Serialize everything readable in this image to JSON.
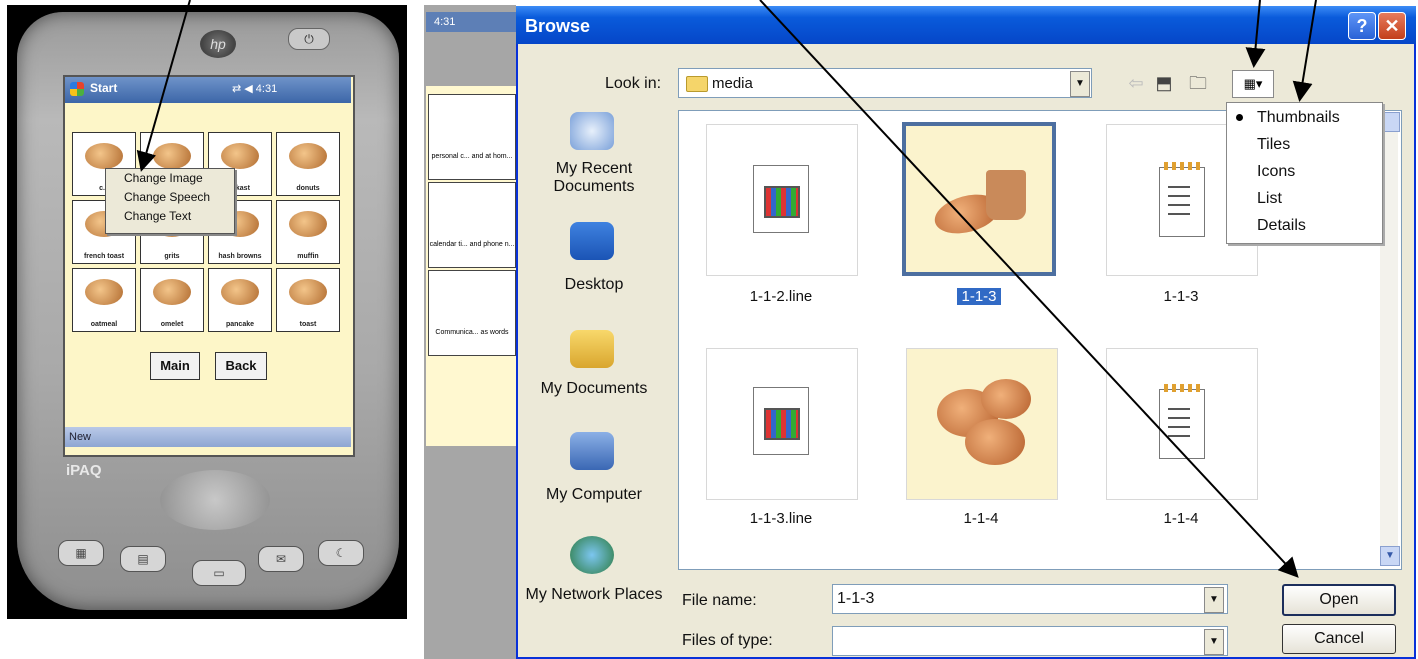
{
  "pda": {
    "start_label": "Start",
    "status_time": "4:31",
    "logo_text": "hp",
    "power_glyph": "⏻",
    "context_menu": [
      "Change Image",
      "Change Speech",
      "Change Text"
    ],
    "tiles": [
      {
        "label": "c..."
      },
      {
        "label": ""
      },
      {
        "label": "...kast"
      },
      {
        "label": "donuts"
      },
      {
        "label": "french toast"
      },
      {
        "label": "grits"
      },
      {
        "label": "hash browns"
      },
      {
        "label": "muffin"
      },
      {
        "label": "oatmeal"
      },
      {
        "label": "omelet"
      },
      {
        "label": "pancake"
      },
      {
        "label": "toast"
      }
    ],
    "main_button": "Main",
    "back_button": "Back",
    "new_label": "New",
    "brand": "iPAQ"
  },
  "background_pda": {
    "status_time": "4:31",
    "tiles": [
      {
        "label": "personal c... and at hom..."
      },
      {
        "label": "calendar ti... and phone n..."
      },
      {
        "label": "Communica... as words"
      }
    ]
  },
  "dialog": {
    "title": "Browse",
    "help_glyph": "?",
    "close_glyph": "✕",
    "look_in_label": "Look in:",
    "look_in_value": "media",
    "places": [
      {
        "label": "My Recent Documents",
        "icon": "recent-documents-icon"
      },
      {
        "label": "Desktop",
        "icon": "desktop-icon"
      },
      {
        "label": "My Documents",
        "icon": "my-documents-icon"
      },
      {
        "label": "My Computer",
        "icon": "my-computer-icon"
      },
      {
        "label": "My Network Places",
        "icon": "network-places-icon"
      }
    ],
    "files": [
      {
        "name": "1-1-2.line",
        "type": "line-file-icon"
      },
      {
        "name": "1-1-3",
        "type": "image-croissant-coffee",
        "selected": true
      },
      {
        "name": "1-1-3",
        "type": "notepad-file-icon"
      },
      {
        "name": "1-1-3.line",
        "type": "line-file-icon"
      },
      {
        "name": "1-1-4",
        "type": "image-donuts"
      },
      {
        "name": "1-1-4",
        "type": "notepad-file-icon"
      }
    ],
    "views_menu": [
      "Thumbnails",
      "Tiles",
      "Icons",
      "List",
      "Details"
    ],
    "views_menu_selected": "Thumbnails",
    "file_name_label": "File name:",
    "file_name_value": "1-1-3",
    "files_of_type_label": "Files of type:",
    "files_of_type_value": "",
    "open_button": "Open",
    "cancel_button": "Cancel",
    "dropdown_glyph": "▼",
    "scroll_down_glyph": "▼"
  }
}
